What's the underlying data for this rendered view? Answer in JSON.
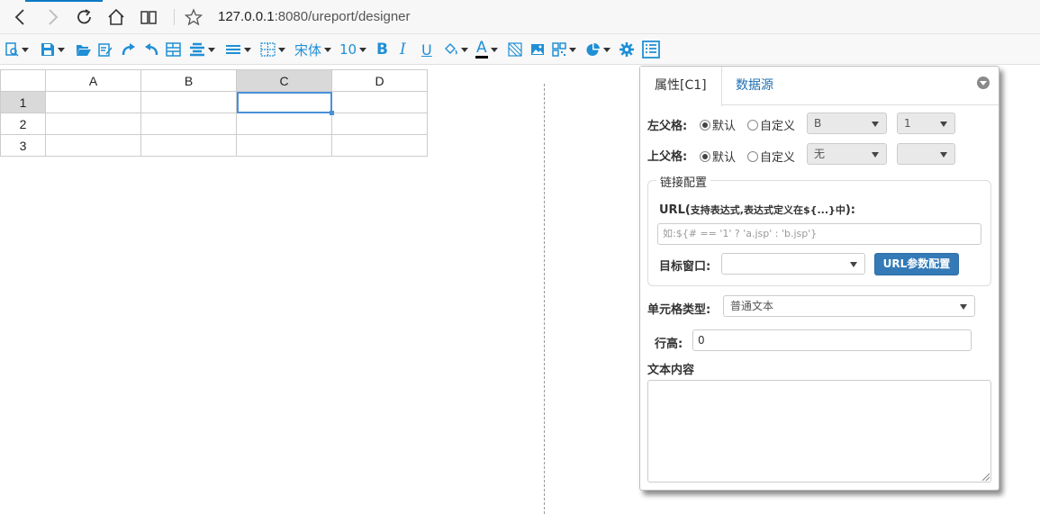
{
  "browser": {
    "url_host": "127.0.0.1",
    "url_rest": ":8080/ureport/designer"
  },
  "toolbar": {
    "font_name": "宋体",
    "font_size": "10",
    "bold": "B",
    "italic": "I",
    "underline": "U",
    "font_color": "A"
  },
  "sheet": {
    "columns": [
      "A",
      "B",
      "C",
      "D"
    ],
    "rows": [
      "1",
      "2",
      "3"
    ],
    "selected_cell": "C1"
  },
  "panel": {
    "tab_properties": "属性[C1]",
    "tab_datasource": "数据源",
    "left_parent_label": "左父格:",
    "top_parent_label": "上父格:",
    "default_label": "默认",
    "custom_label": "自定义",
    "left_parent_col": "B",
    "left_parent_row": "1",
    "top_parent_col": "无",
    "top_parent_row": "",
    "link_section_title": "链接配置",
    "url_label_prefix": "URL(",
    "url_label_hint": "支持表达式,表达式定义在${...}中",
    "url_label_suffix": "):",
    "url_placeholder": "如:${# == '1' ? 'a.jsp' : 'b.jsp'}",
    "target_window_label": "目标窗口:",
    "target_window_value": "",
    "url_params_button": "URL参数配置",
    "cell_type_label": "单元格类型:",
    "cell_type_value": "普通文本",
    "row_height_label": "行高:",
    "row_height_value": "0",
    "text_content_label": "文本内容",
    "text_content_value": ""
  }
}
